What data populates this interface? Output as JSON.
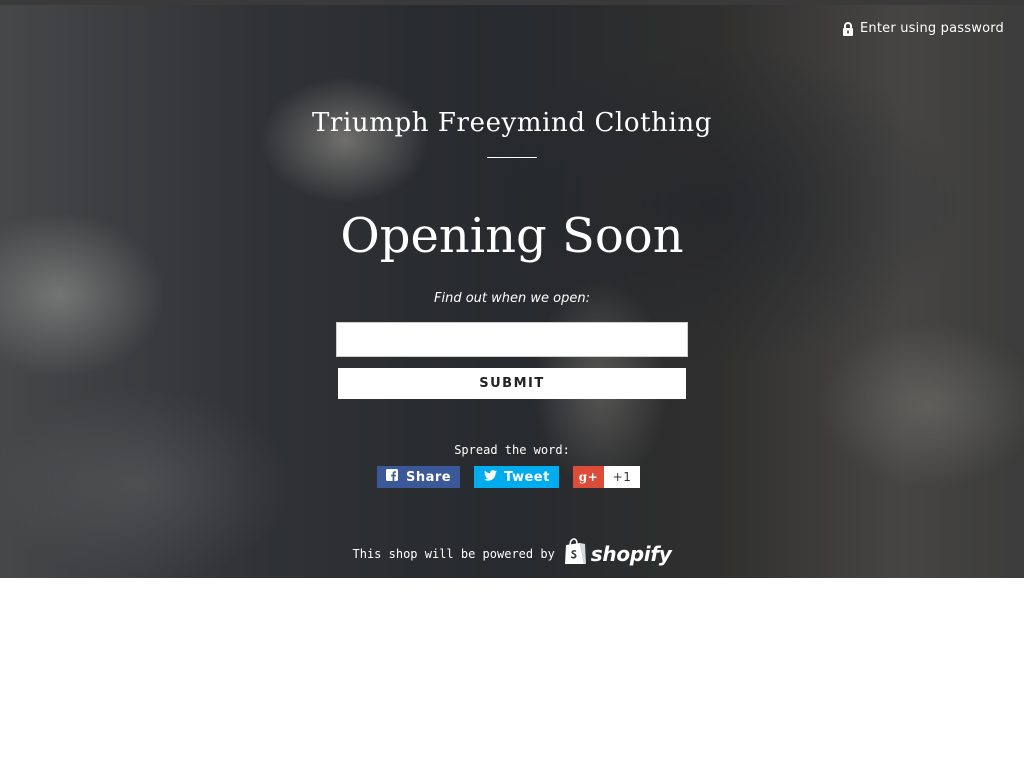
{
  "header": {
    "password_link_label": "Enter using password",
    "lock_icon": "lock-icon"
  },
  "store": {
    "name": "Triumph Freeymind Clothing"
  },
  "main": {
    "headline": "Opening Soon",
    "subline": "Find out when we open:",
    "email_input": {
      "value": "",
      "placeholder": ""
    },
    "submit_label": "SUBMIT"
  },
  "social": {
    "title": "Spread the word:",
    "facebook": {
      "label": "Share",
      "icon": "facebook-icon",
      "color": "#3b5998"
    },
    "twitter": {
      "label": "Tweet",
      "icon": "twitter-icon",
      "color": "#00aced"
    },
    "googleplus": {
      "icon_label": "g+",
      "count": "+1",
      "icon": "google-plus-icon",
      "color": "#dd4b39"
    }
  },
  "footer": {
    "powered_text": "This shop will be powered by",
    "brand": "shopify",
    "brand_icon": "shopify-bag-icon"
  }
}
